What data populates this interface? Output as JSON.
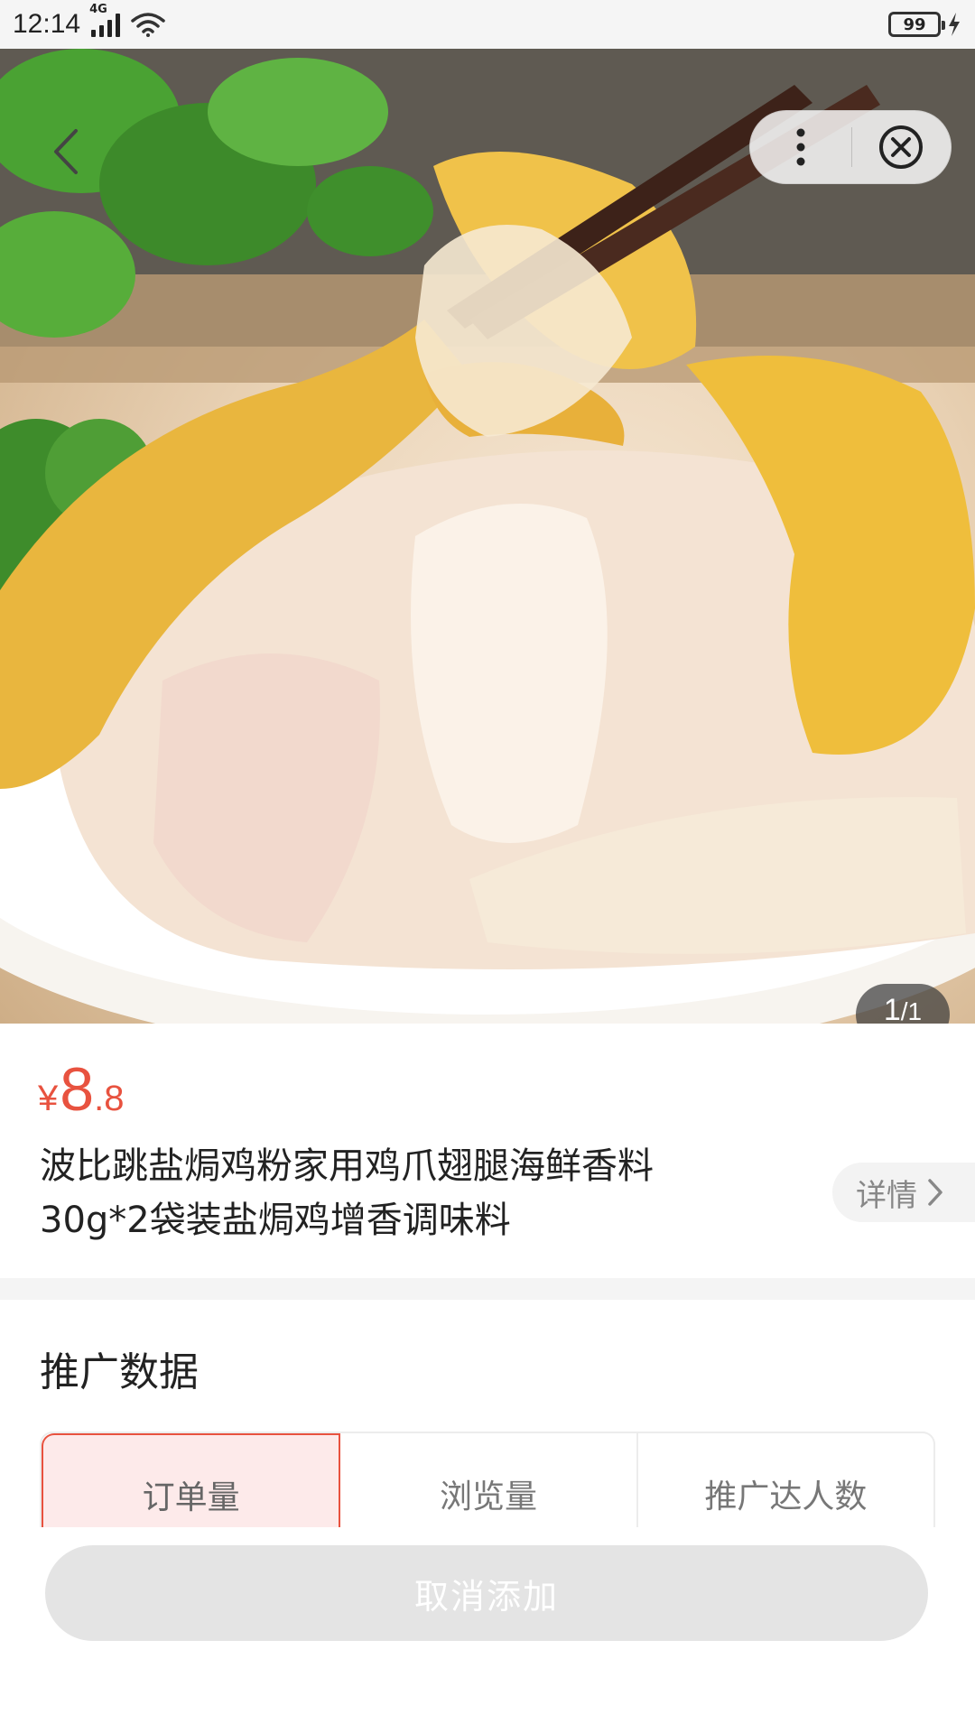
{
  "status_bar": {
    "time": "12:14",
    "network": "4G",
    "battery": "99"
  },
  "gallery": {
    "current": "1",
    "total": "/1"
  },
  "product": {
    "price_symbol": "¥",
    "price_integer": "8",
    "price_decimal": ".8",
    "title_line1": "波比跳盐焗鸡粉家用鸡爪翅腿海鲜香料",
    "title_line2": "30g*2袋装盐焗鸡增香调味料",
    "detail_label": "详情"
  },
  "promo": {
    "section_title": "推广数据",
    "tabs": [
      {
        "label": "订单量",
        "active": true
      },
      {
        "label": "浏览量",
        "active": false
      },
      {
        "label": "推广达人数",
        "active": false
      }
    ]
  },
  "footer": {
    "cancel_label": "取消添加"
  },
  "colors": {
    "accent": "#e8523f",
    "active_tab_bg": "#fdeaea",
    "disabled_button": "#e4e4e4"
  }
}
